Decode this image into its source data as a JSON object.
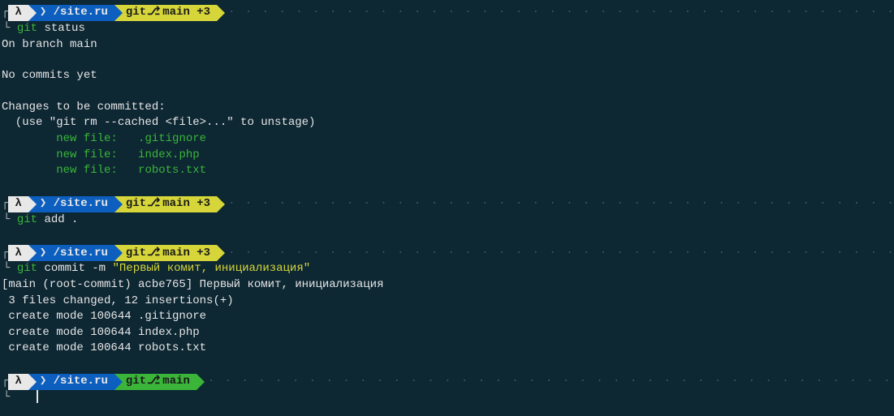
{
  "segments": {
    "caret": "❯",
    "path": "/site.ru",
    "git_label": "git",
    "git_branch": "main",
    "git_dirty_suffix": "+3",
    "branch_icon": "⎇"
  },
  "dots": "· · · · · · · · · · · · · · · · · · · · · · · · · · · · · · · · · · · · · · · · · · · · · · · · · · · · · · · · · · · · · · · · · · · · · · · · · · · · · · · · · · · · · · · · · · · · · · · · · · · · · · · · · · · · · · · · · · · · · · ·",
  "block1": {
    "command": {
      "git": "git",
      "sub": "status"
    },
    "output": {
      "l1": "On branch main",
      "l2": "No commits yet",
      "l3": "Changes to be committed:",
      "l4": "  (use \"git rm --cached <file>...\" to unstage)",
      "nf": "new file:   ",
      "f1": ".gitignore",
      "f2": "index.php",
      "f3": "robots.txt"
    }
  },
  "block2": {
    "command": {
      "git": "git",
      "sub": "add ."
    }
  },
  "block3": {
    "command": {
      "git": "git",
      "sub": "commit",
      "flag": "-m",
      "string": "\"Первый комит, инициализация\""
    },
    "output": {
      "l1": "[main (root-commit) acbe765] Первый комит, инициализация",
      "l2": " 3 files changed, 12 insertions(+)",
      "l3": " create mode 100644 .gitignore",
      "l4": " create mode 100644 index.php",
      "l5": " create mode 100644 robots.txt"
    }
  },
  "lambda": "λ"
}
